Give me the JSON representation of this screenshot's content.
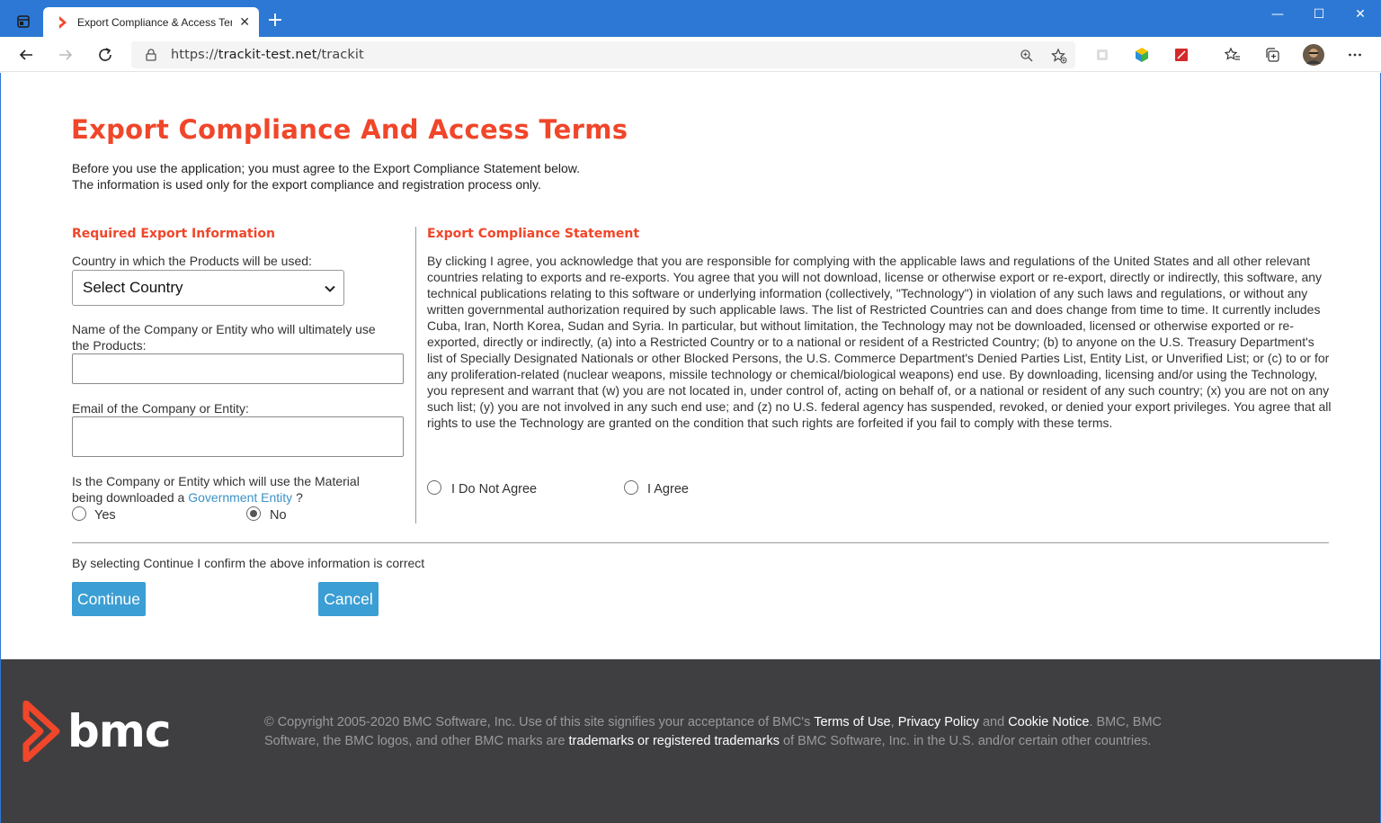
{
  "browser": {
    "tab_title": "Export Compliance & Access Terr",
    "tab_close": "✕",
    "new_tab": "+",
    "url_scheme": "https://",
    "url_host": "trackit-test.net",
    "url_path": "/trackit",
    "window_controls": {
      "minimize": "—",
      "maximize": "☐",
      "close": "✕"
    }
  },
  "page": {
    "title": "Export Compliance And Access Terms",
    "intro_line1": "Before you use the application; you must agree to the Export Compliance Statement below.",
    "intro_line2": "The information is used only for the export compliance and registration process only."
  },
  "required": {
    "heading": "Required Export Information",
    "country_label": "Country in which the Products will be used:",
    "country_value": "Select Country",
    "company_label_line1": "Name of the Company or Entity who will ultimately use",
    "company_label_line2": "the Products:",
    "company_value": "",
    "email_label": "Email of the Company or Entity:",
    "email_value": "",
    "gov_question_line1": "Is the Company or Entity which will use the Material",
    "gov_question_prefix": "being downloaded a",
    "gov_question_link": "Government Entity",
    "gov_question_suffix": "?",
    "gov_yes_label": "Yes",
    "gov_no_label": "No",
    "gov_selected": "No"
  },
  "statement": {
    "heading": "Export Compliance Statement",
    "body": "By clicking I agree, you acknowledge that you are responsible for complying with the applicable laws and regulations of the United States and all other relevant countries relating to exports and re-exports. You agree that you will not download, license or otherwise export or re-export, directly or indirectly, this software, any technical publications relating to this software or underlying information (collectively, \"Technology\") in violation of any such laws and regulations, or without any written governmental authorization required by such applicable laws. The list of Restricted Countries can and does change from time to time. It currently includes Cuba, Iran, North Korea, Sudan and Syria. In particular, but without limitation, the Technology may not be downloaded, licensed or otherwise exported or re-exported, directly or indirectly, (a) into a Restricted Country or to a national or resident of a Restricted Country; (b) to anyone on the U.S. Treasury Department's list of Specially Designated Nationals or other Blocked Persons, the U.S. Commerce Department's Denied Parties List, Entity List, or Unverified List; or (c) to or for any proliferation-related (nuclear weapons, missile technology or chemical/biological weapons) end use. By downloading, licensing and/or using the Technology, you represent and warrant that (w) you are not located in, under control of, acting on behalf of, or a national or resident of any such country; (x) you are not on any such list; (y) you are not involved in any such end use; and (z) no U.S. federal agency has suspended, revoked, or denied your export privileges. You agree that all rights to use the Technology are granted on the condition that such rights are forfeited if you fail to comply with these terms.",
    "disagree_label": "I Do Not Agree",
    "agree_label": "I Agree"
  },
  "confirm": {
    "text": "By selecting Continue I confirm the above information is correct",
    "continue_label": "Continue",
    "cancel_label": "Cancel"
  },
  "footer": {
    "logo_text": "bmc",
    "copy_1": "© Copyright 2005-2020 BMC Software, Inc. Use of this site signifies your acceptance of BMC's ",
    "link_terms": "Terms of Use",
    "sep_1": ", ",
    "link_privacy": "Privacy Policy",
    "sep_2": " and ",
    "link_cookie": "Cookie Notice",
    "copy_2": ". BMC, BMC Software, the BMC logos, and other BMC marks are ",
    "link_trademarks": "trademarks or registered trademarks",
    "copy_3": " of BMC Software, Inc. in the U.S. and/or certain other countries."
  },
  "colors": {
    "brand_orange": "#f0462a",
    "button_blue": "#3b9ed4",
    "link_blue": "#3a92c8",
    "footer_bg": "#3f3f42",
    "titlebar_blue": "#2d78d4"
  }
}
